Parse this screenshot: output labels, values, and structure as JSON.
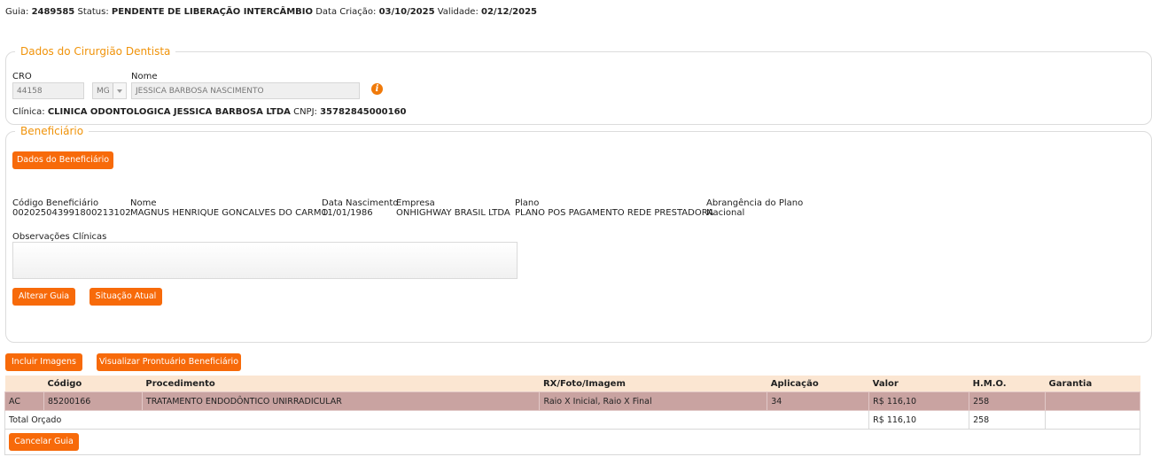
{
  "header": {
    "guia_label": "Guia:",
    "guia_value": "2489585",
    "status_label": "Status:",
    "status_value": "PENDENTE DE LIBERAÇÃO INTERCÂMBIO",
    "criacao_label": "Data Criação:",
    "criacao_value": "03/10/2025",
    "validade_label": "Validade:",
    "validade_value": "02/12/2025"
  },
  "dentista": {
    "legend": "Dados do Cirurgião Dentista",
    "cro_label": "CRO",
    "cro_value": "44158",
    "uf_value": "MG",
    "nome_label": "Nome",
    "nome_value": "JESSICA BARBOSA NASCIMENTO",
    "info_icon": "i",
    "clinica_label": "Clínica:",
    "clinica_value": "CLINICA ODONTOLOGICA JESSICA BARBOSA LTDA",
    "cnpj_label": "CNPJ:",
    "cnpj_value": "35782845000160"
  },
  "beneficiario": {
    "legend": "Beneficiário",
    "dados_button": "Dados do Beneficiário",
    "codigo_label": "Código Beneficiário",
    "codigo_value": "00202504399180021310​2",
    "nome_label": "Nome",
    "nome_value": "MAGNUS HENRIQUE GONCALVES DO CARMO",
    "nascimento_label": "Data Nascimento",
    "nascimento_value": "11/01/1986",
    "empresa_label": "Empresa",
    "empresa_value": "ONHIGHWAY BRASIL LTDA",
    "plano_label": "Plano",
    "plano_value": "PLANO POS PAGAMENTO REDE PRESTADORA",
    "abrangencia_label": "Abrangência do Plano",
    "abrangencia_value": "Nacional",
    "obs_label": "Observações Clínicas",
    "alterar_button": "Alterar Guia",
    "situacao_button": "Situação Atual"
  },
  "actions": {
    "incluir_button": "Incluir Imagens",
    "prontuario_button": "Visualizar Prontuário Beneficiário",
    "cancelar_button": "Cancelar Guia"
  },
  "table": {
    "headers": [
      "",
      "Código",
      "Procedimento",
      "RX/Foto/Imagem",
      "Aplicação",
      "Valor",
      "H.M.O.",
      "Garantia"
    ],
    "row": [
      "AC",
      "85200166",
      "TRATAMENTO ENDODÔNTICO UNIRRADICULAR",
      "Raio X Inicial, Raio X Final",
      "34",
      "R$ 116,10",
      "258",
      ""
    ],
    "total_label": "Total Orçado",
    "total_valor": "R$ 116,10",
    "total_hmo": "258"
  },
  "colors": {
    "accent": "#f76a0a",
    "legend": "#f0930a",
    "selected_row": "#c9a3a1",
    "table_header": "#fbe6d2"
  }
}
